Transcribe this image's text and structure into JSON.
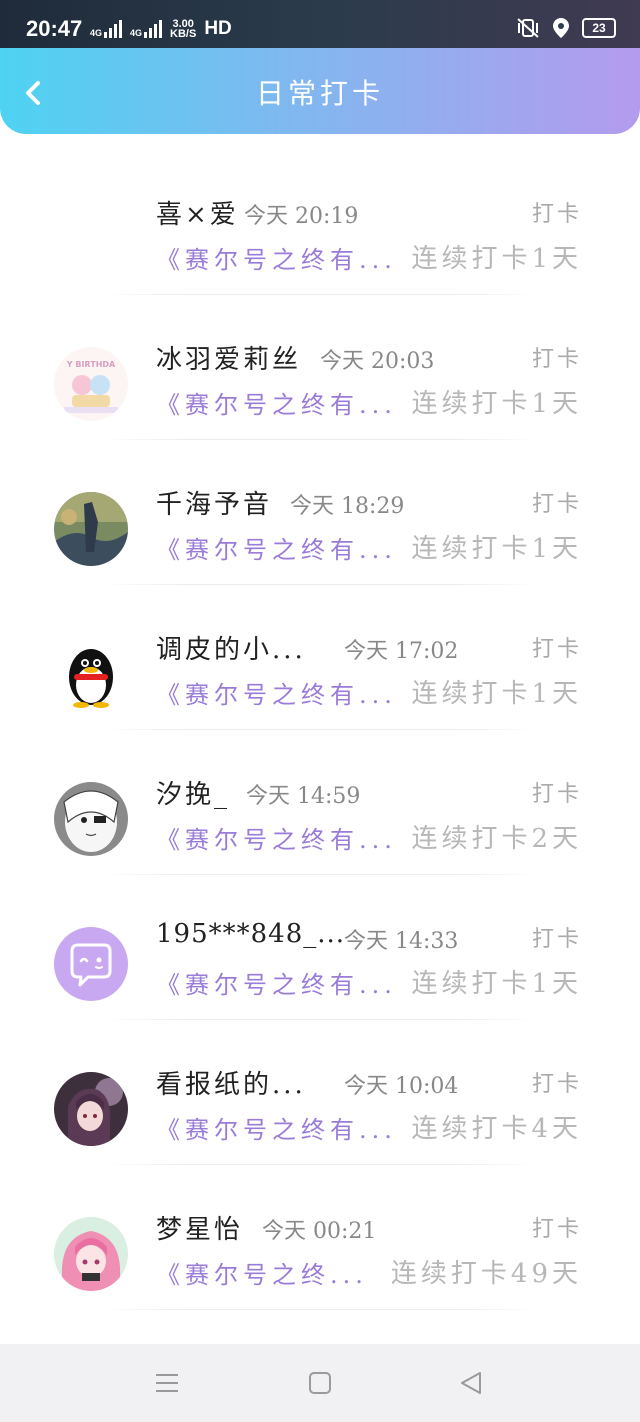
{
  "status_bar": {
    "time": "20:47",
    "net1": "4G",
    "net2": "4G",
    "speed_value": "3.00",
    "speed_unit": "KB/S",
    "hd": "HD",
    "battery": "23"
  },
  "header": {
    "title": "日常打卡",
    "back_icon": "chevron-left-icon",
    "gradient": [
      "#4ed3f2",
      "#b49bee"
    ]
  },
  "items": [
    {
      "name": "喜×爱",
      "time": "今天 20:19",
      "action": "打卡",
      "book": "《赛尔号之终有...",
      "streak": "连续打卡1天",
      "avatar": "none"
    },
    {
      "name": "冰羽爱莉丝",
      "time": "今天 20:03",
      "action": "打卡",
      "book": "《赛尔号之终有...",
      "streak": "连续打卡1天",
      "avatar": "birthday-cartoon",
      "avatar_text": "Y BIRTHDA"
    },
    {
      "name": "千海予音",
      "time": "今天 18:29",
      "action": "打卡",
      "book": "《赛尔号之终有...",
      "streak": "连续打卡1天",
      "avatar": "painting"
    },
    {
      "name": "调皮的小...",
      "time": "今天 17:02",
      "action": "打卡",
      "book": "《赛尔号之终有...",
      "streak": "连续打卡1天",
      "avatar": "penguin"
    },
    {
      "name": "汐挽_",
      "time": "今天 14:59",
      "action": "打卡",
      "book": "《赛尔号之终有...",
      "streak": "连续打卡2天",
      "avatar": "anime-sketch"
    },
    {
      "name": "195***848_...",
      "time": "今天 14:33",
      "action": "打卡",
      "book": "《赛尔号之终有...",
      "streak": "连续打卡1天",
      "avatar": "default-chat"
    },
    {
      "name": "看报纸的...",
      "time": "今天 10:04",
      "action": "打卡",
      "book": "《赛尔号之终有...",
      "streak": "连续打卡4天",
      "avatar": "anime-dark"
    },
    {
      "name": "梦星怡",
      "time": "今天 00:21",
      "action": "打卡",
      "book": "《赛尔号之终...",
      "streak": "连续打卡49天",
      "avatar": "anime-pink"
    }
  ],
  "navbar": {
    "menu_icon": "menu-icon",
    "home_icon": "square-home-icon",
    "back_icon": "triangle-back-icon"
  },
  "colors": {
    "book": "#9a7cd8",
    "streak": "#b7b7b7",
    "default_avatar": "#c9a8f2"
  }
}
